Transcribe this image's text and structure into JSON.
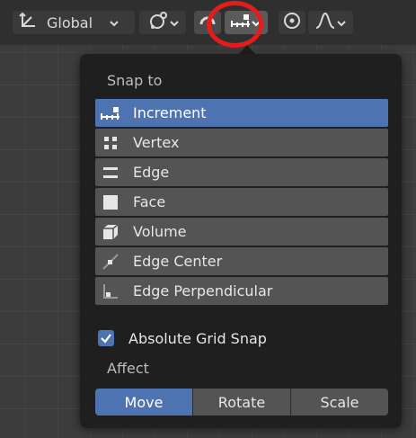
{
  "header": {
    "orientation_label": "Global",
    "snap_target_icon": "snap-increment-icon",
    "pivot_icon": "link-icon",
    "snap_icon": "magnet-icon",
    "proportional_icon": "circle-dot-icon",
    "falloff_icon": "falloff-curve-icon",
    "highlight_color": "#e41c1c"
  },
  "popover": {
    "snap_to_label": "Snap to",
    "snap_items": [
      {
        "label": "Increment",
        "icon": "increment-icon",
        "active": true
      },
      {
        "label": "Vertex",
        "icon": "vertex-icon",
        "active": false
      },
      {
        "label": "Edge",
        "icon": "edge-icon",
        "active": false
      },
      {
        "label": "Face",
        "icon": "face-icon",
        "active": false
      },
      {
        "label": "Volume",
        "icon": "volume-icon",
        "active": false
      },
      {
        "label": "Edge Center",
        "icon": "edge-center-icon",
        "active": false
      },
      {
        "label": "Edge Perpendicular",
        "icon": "edge-perpendicular-icon",
        "active": false
      }
    ],
    "absolute_grid_snap": {
      "label": "Absolute Grid Snap",
      "checked": true
    },
    "affect_label": "Affect",
    "affect_buttons": [
      {
        "label": "Move",
        "active": true
      },
      {
        "label": "Rotate",
        "active": false
      },
      {
        "label": "Scale",
        "active": false
      }
    ],
    "accent_color": "#4d74b0"
  }
}
